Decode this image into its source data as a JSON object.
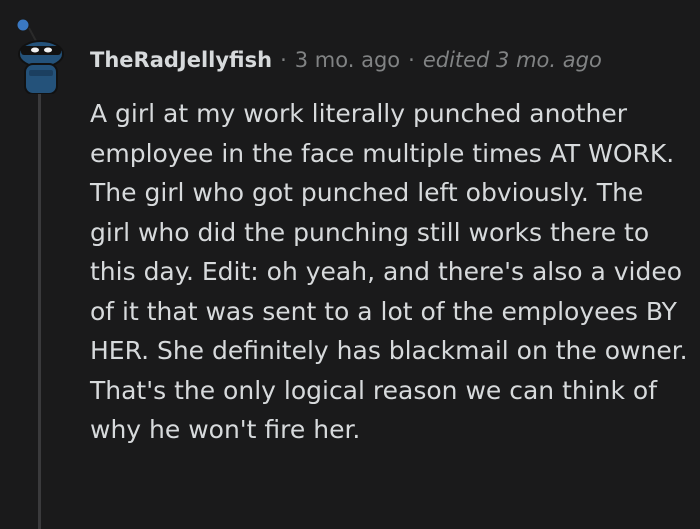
{
  "comment": {
    "username": "TheRadJellyfish",
    "timestamp": "3 mo. ago",
    "edited": "edited 3 mo. ago",
    "separator": "·",
    "body": "A girl at my work literally punched another employee in the face multiple times AT WORK. The girl who got punched left obviously. The girl who did the punching still works there to this day. Edit: oh yeah, and there's also a video of it that was sent to a lot of the employees BY HER. She definitely has blackmail on the owner. That's the only logical reason we can think of why he won't fire her."
  },
  "colors": {
    "background": "#1a1a1b",
    "text": "#d7dadc",
    "muted": "#818384",
    "avatar_blue": "#24527a",
    "thread_line": "#3a3a3c"
  },
  "icons": {
    "avatar": "snoo-avatar-icon"
  }
}
